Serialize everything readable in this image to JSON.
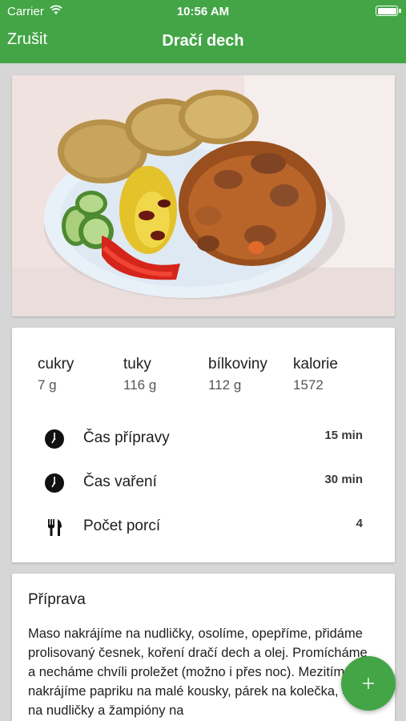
{
  "status_bar": {
    "carrier": "Carrier",
    "time": "10:56 AM",
    "icons": [
      "wifi-icon",
      "battery-icon"
    ]
  },
  "nav": {
    "cancel_label": "Zrušit",
    "title": "Dračí dech"
  },
  "photo": {
    "description_icon": "food-photo"
  },
  "nutrition": [
    {
      "label": "cukry",
      "value": "7 g"
    },
    {
      "label": "tuky",
      "value": "116 g"
    },
    {
      "label": "bílkoviny",
      "value": "112 g"
    },
    {
      "label": "kalorie",
      "value": "1572"
    }
  ],
  "details": [
    {
      "icon": "clock-icon",
      "label": "Čas přípravy",
      "value": "15 min"
    },
    {
      "icon": "clock-icon",
      "label": "Čas vaření",
      "value": "30 min"
    },
    {
      "icon": "fork-knife-icon",
      "label": "Počet porcí",
      "value": "4"
    }
  ],
  "preparation": {
    "title": "Příprava",
    "text": "Maso nakrájíme na nudličky, osolíme, opepříme, přidáme prolisovaný česnek, koření dračí dech a olej. Promícháme a necháme chvíli proležet (možno i přes noc). Mezitím si nakrájíme papriku na malé kousky, párek na kolečka, cibuli na nudličky a žampióny na"
  },
  "fab": {
    "icon": "plus-icon"
  },
  "colors": {
    "accent": "#43a546",
    "background": "#d6d6d6",
    "card": "#ffffff"
  }
}
